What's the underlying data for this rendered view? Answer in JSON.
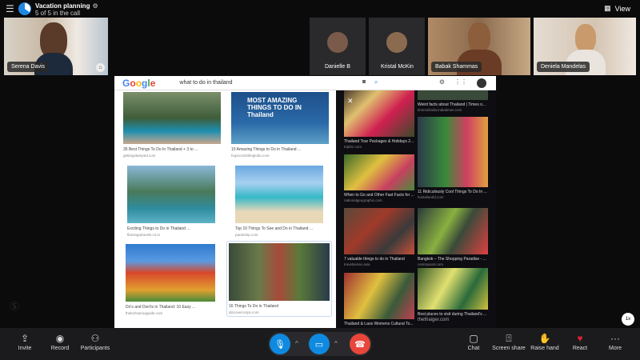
{
  "header": {
    "title": "Vacation planning",
    "subtitle": "5 of 5 in the call",
    "view_label": "View"
  },
  "participants": [
    {
      "name": "Serena Davis",
      "color": "#c9a88a"
    },
    {
      "name": "Danielle B",
      "color": "#7a5a4a"
    },
    {
      "name": "Kristal McKin",
      "color": "#8a6b50"
    },
    {
      "name": "Babak Shammas",
      "color": "#9b6a45"
    },
    {
      "name": "Deniela Mandelas",
      "color": "#d9c3b0"
    }
  ],
  "share": {
    "logo": "Google",
    "query": "what to do in thailand",
    "left_results": [
      {
        "title": "35 Best Things To Do In Thailand + 3 to ...",
        "source": "gettingstamped.com"
      },
      {
        "title": "10 Amazing Things to Do in Thailand ...",
        "source": "hopscotchtheglobe.com",
        "overlay": "MOST AMAZING THINGS TO DO IN Thailand"
      },
      {
        "title": "Exciting Things to Do in Thailand ...",
        "source": "flamingotravels.co.in"
      },
      {
        "title": "Top 10 Things To See and Do in Thailand ...",
        "source": "pandotrip.com"
      },
      {
        "title": "Do's and Don'ts in Thailand: 10 Easy ...",
        "source": "thekohsamuiguide.com"
      },
      {
        "title": "16 Things To Do in Thailand",
        "source": "discovercorps.com"
      }
    ],
    "right_results": [
      {
        "title": "Thailand Tour Packages & Holidays 2...",
        "source": "tripfez.com"
      },
      {
        "title": "Weird facts about Thailand | Times o...",
        "source": "timesofindia.indiatimes.com"
      },
      {
        "title": "When to Go and Other Fast Facts for ...",
        "source": "nationalgeographic.com"
      },
      {
        "title": "11 Ridiculously Cool Things To Do In ...",
        "source": "hostelworld.com"
      },
      {
        "title": "7 valuable things to do in Thailand",
        "source": "travelsense.asia"
      },
      {
        "title": "Bangkok – The Shopping Paradise - ...",
        "source": "centrepoint.com"
      },
      {
        "title": "Thailand & Laos Womens Cultural To...",
        "source": ""
      },
      {
        "title": "Best places to visit during Thailand's ...",
        "source": "thethaiger.com"
      }
    ]
  },
  "zoom_label": "1x",
  "toolbar": {
    "invite": "Invite",
    "record": "Record",
    "participants": "Participants",
    "chat": "Chat",
    "screen_share": "Screen share",
    "raise_hand": "Raise hand",
    "react": "React",
    "more": "More"
  },
  "colors": {
    "accent": "#0f8ae0",
    "hangup": "#e8463b"
  }
}
